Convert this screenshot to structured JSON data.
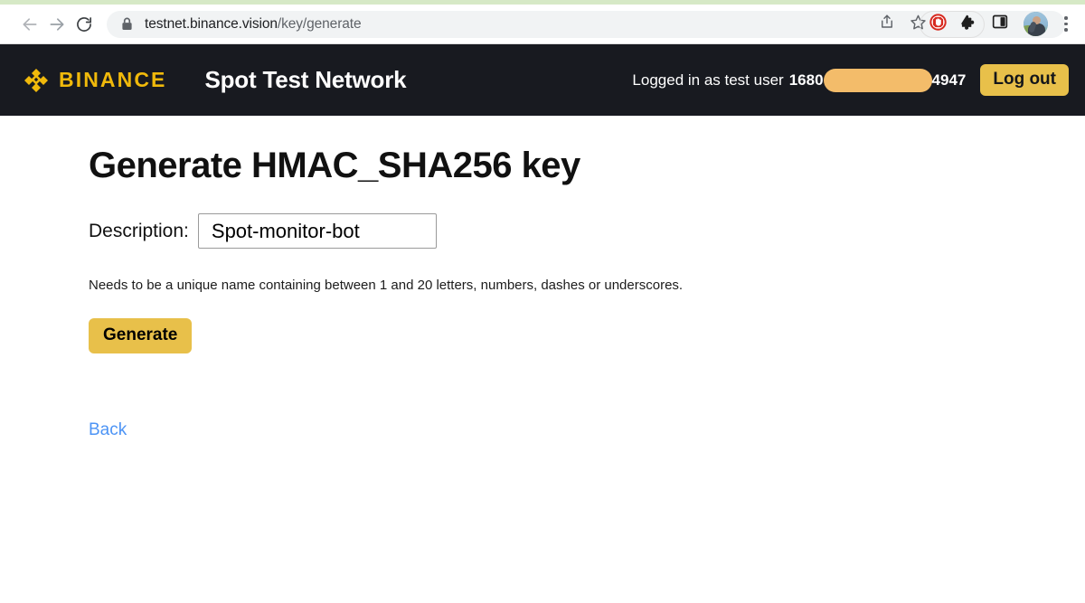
{
  "browser": {
    "back_icon": "arrow-left-icon",
    "forward_icon": "arrow-right-icon",
    "reload_icon": "reload-icon",
    "lock_icon": "lock-icon",
    "url_domain": "testnet.binance.vision",
    "url_path": "/key/generate",
    "share_icon": "share-icon",
    "bookmark_icon": "star-icon",
    "adblock_icon": "adblock-icon",
    "extensions_icon": "puzzle-icon",
    "side_panel_icon": "side-panel-icon",
    "avatar_icon": "profile-avatar",
    "menu_icon": "three-dot-menu-icon"
  },
  "navbar": {
    "brand_logo_icon": "binance-logo-icon",
    "brand_name": "BINANCE",
    "site_title": "Spot Test Network",
    "logged_in_prefix": "Logged in as test user",
    "user_id_start": "1680",
    "user_id_end": "4947",
    "logout_label": "Log out",
    "brand_color": "#f0b90b",
    "bar_color": "#181a20",
    "button_color": "#e8c04a",
    "redaction_color": "#f3bc6a"
  },
  "main": {
    "page_title": "Generate HMAC_SHA256 key",
    "description_label": "Description:",
    "description_value": "Spot-monitor-bot",
    "description_placeholder": "",
    "hint": "Needs to be a unique name containing between 1 and 20 letters, numbers, dashes or underscores.",
    "generate_label": "Generate",
    "back_label": "Back",
    "link_color": "#4d94f5"
  }
}
